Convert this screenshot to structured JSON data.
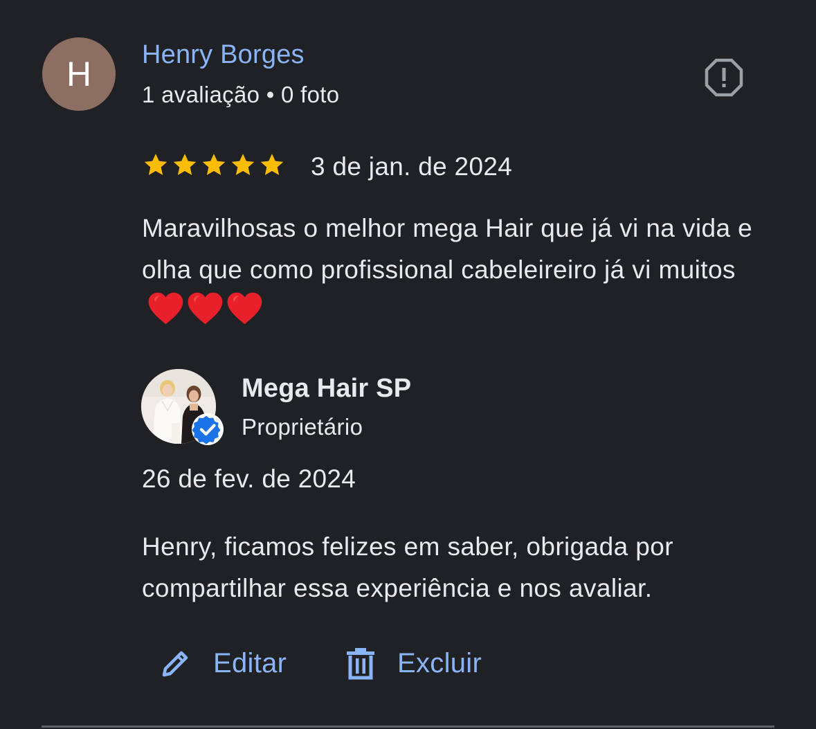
{
  "review": {
    "avatar_letter": "H",
    "avatar_color": "#8d6e63",
    "reviewer_name": "Henry Borges",
    "reviewer_meta": "1 avaliação • 0 foto",
    "report_icon": "report-icon",
    "rating": 5,
    "rating_max": 5,
    "date": "3 de jan. de 2024",
    "text": "Maravilhosas o melhor mega Hair que já vi na vida e olha que como profissional cabeleireiro já vi muitos",
    "emoji_hearts": "❤️❤️❤️"
  },
  "owner_reply": {
    "name": "Mega Hair SP",
    "role": "Proprietário",
    "verified_icon": "verified-badge-icon",
    "date": "26 de fev. de 2024",
    "text": "Henry, ficamos felizes em saber, obrigada por compartilhar essa experiência e nos avaliar."
  },
  "actions": {
    "edit_label": "Editar",
    "edit_icon": "pencil-icon",
    "delete_label": "Excluir",
    "delete_icon": "trash-icon"
  },
  "colors": {
    "background": "#202124",
    "link_blue": "#8ab4f8",
    "text": "#e8eaed",
    "star": "#fbbc04",
    "heart": "#e8202a",
    "verified": "#1a73e8"
  }
}
